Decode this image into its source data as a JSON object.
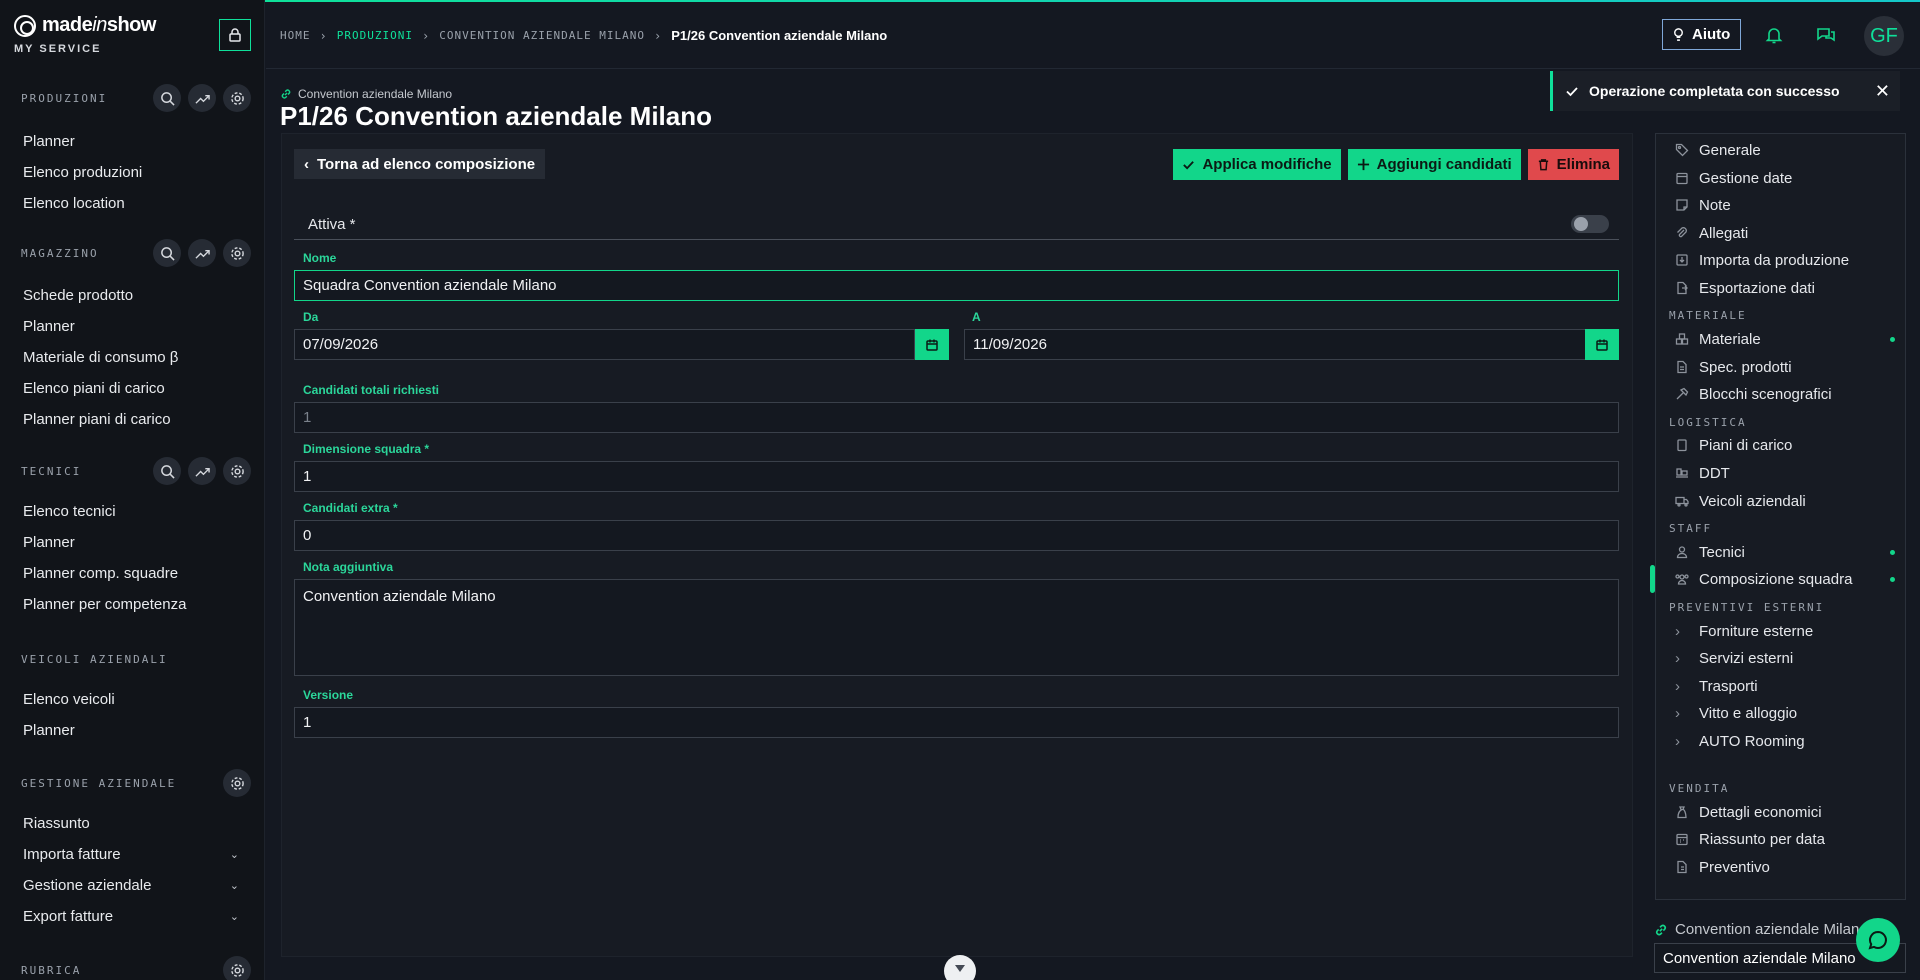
{
  "brand": {
    "logo_made": "made",
    "logo_in": "in",
    "logo_show": "show",
    "subtitle": "MY SERVICE"
  },
  "nav": {
    "produzioni": {
      "title": "PRODUZIONI",
      "items": [
        "Planner",
        "Elenco produzioni",
        "Elenco location"
      ]
    },
    "magazzino": {
      "title": "MAGAZZINO",
      "items": [
        "Schede prodotto",
        "Planner",
        "Materiale di consumo β",
        "Elenco piani di carico",
        "Planner piani di carico"
      ]
    },
    "tecnici": {
      "title": "TECNICI",
      "items": [
        "Elenco tecnici",
        "Planner",
        "Planner comp. squadre",
        "Planner per competenza"
      ]
    },
    "veicoli": {
      "title": "VEICOLI AZIENDALI",
      "items": [
        "Elenco veicoli",
        "Planner"
      ]
    },
    "gestione": {
      "title": "GESTIONE AZIENDALE",
      "items": [
        "Riassunto",
        "Importa fatture",
        "Gestione aziendale",
        "Export fatture"
      ]
    },
    "rubrica": {
      "title": "RUBRICA"
    }
  },
  "breadcrumb": {
    "home": "HOME",
    "produzioni": "PRODUZIONI",
    "convention": "CONVENTION AZIENDALE MILANO",
    "current": "P1/26 Convention aziendale Milano"
  },
  "header": {
    "help_label": "Aiuto",
    "avatar_initials": "GF"
  },
  "page": {
    "link_label": "Convention aziendale Milano",
    "title": "P1/26 Convention aziendale Milano"
  },
  "toast": {
    "message": "Operazione completata con successo"
  },
  "form": {
    "back_label": "Torna ad elenco composizione",
    "apply_label": "Applica modifiche",
    "add_label": "Aggiungi candidati",
    "delete_label": "Elimina",
    "attiva_label": "Attiva *",
    "nome_label": "Nome",
    "nome_value": "Squadra Convention aziendale Milano",
    "da_label": "Da",
    "da_value": "07/09/2026",
    "a_label": "A",
    "a_value": "11/09/2026",
    "candidati_totali_label": "Candidati totali richiesti",
    "candidati_totali_value": "1",
    "dimensione_label": "Dimensione squadra *",
    "dimensione_value": "1",
    "extra_label": "Candidati extra *",
    "extra_value": "0",
    "nota_label": "Nota aggiuntiva",
    "nota_value": "Convention aziendale Milano",
    "versione_label": "Versione",
    "versione_value": "1"
  },
  "sidemenu": {
    "generale": "Generale",
    "gestione_date": "Gestione date",
    "note": "Note",
    "allegati": "Allegati",
    "importa": "Importa da produzione",
    "esportazione": "Esportazione dati",
    "materiale_head": "MATERIALE",
    "materiale": "Materiale",
    "spec": "Spec. prodotti",
    "blocchi": "Blocchi scenografici",
    "logistica_head": "LOGISTICA",
    "piani": "Piani di carico",
    "ddt": "DDT",
    "veicoli": "Veicoli aziendali",
    "staff_head": "STAFF",
    "tecnici": "Tecnici",
    "composizione": "Composizione squadra",
    "preventivi_head": "PREVENTIVI ESTERNI",
    "forniture": "Forniture esterne",
    "servizi": "Servizi esterni",
    "trasporti": "Trasporti",
    "vitto": "Vitto e alloggio",
    "auto_rooming": "AUTO Rooming",
    "vendita_head": "VENDITA",
    "dettagli": "Dettagli economici",
    "riassunto": "Riassunto per data",
    "preventivo": "Preventivo"
  },
  "footer": {
    "link_label": "Convention aziendale Milano",
    "select_value": "Convention aziendale Milano"
  },
  "colors": {
    "accent": "#12d68a",
    "danger": "#e0494c",
    "background": "#141821"
  }
}
